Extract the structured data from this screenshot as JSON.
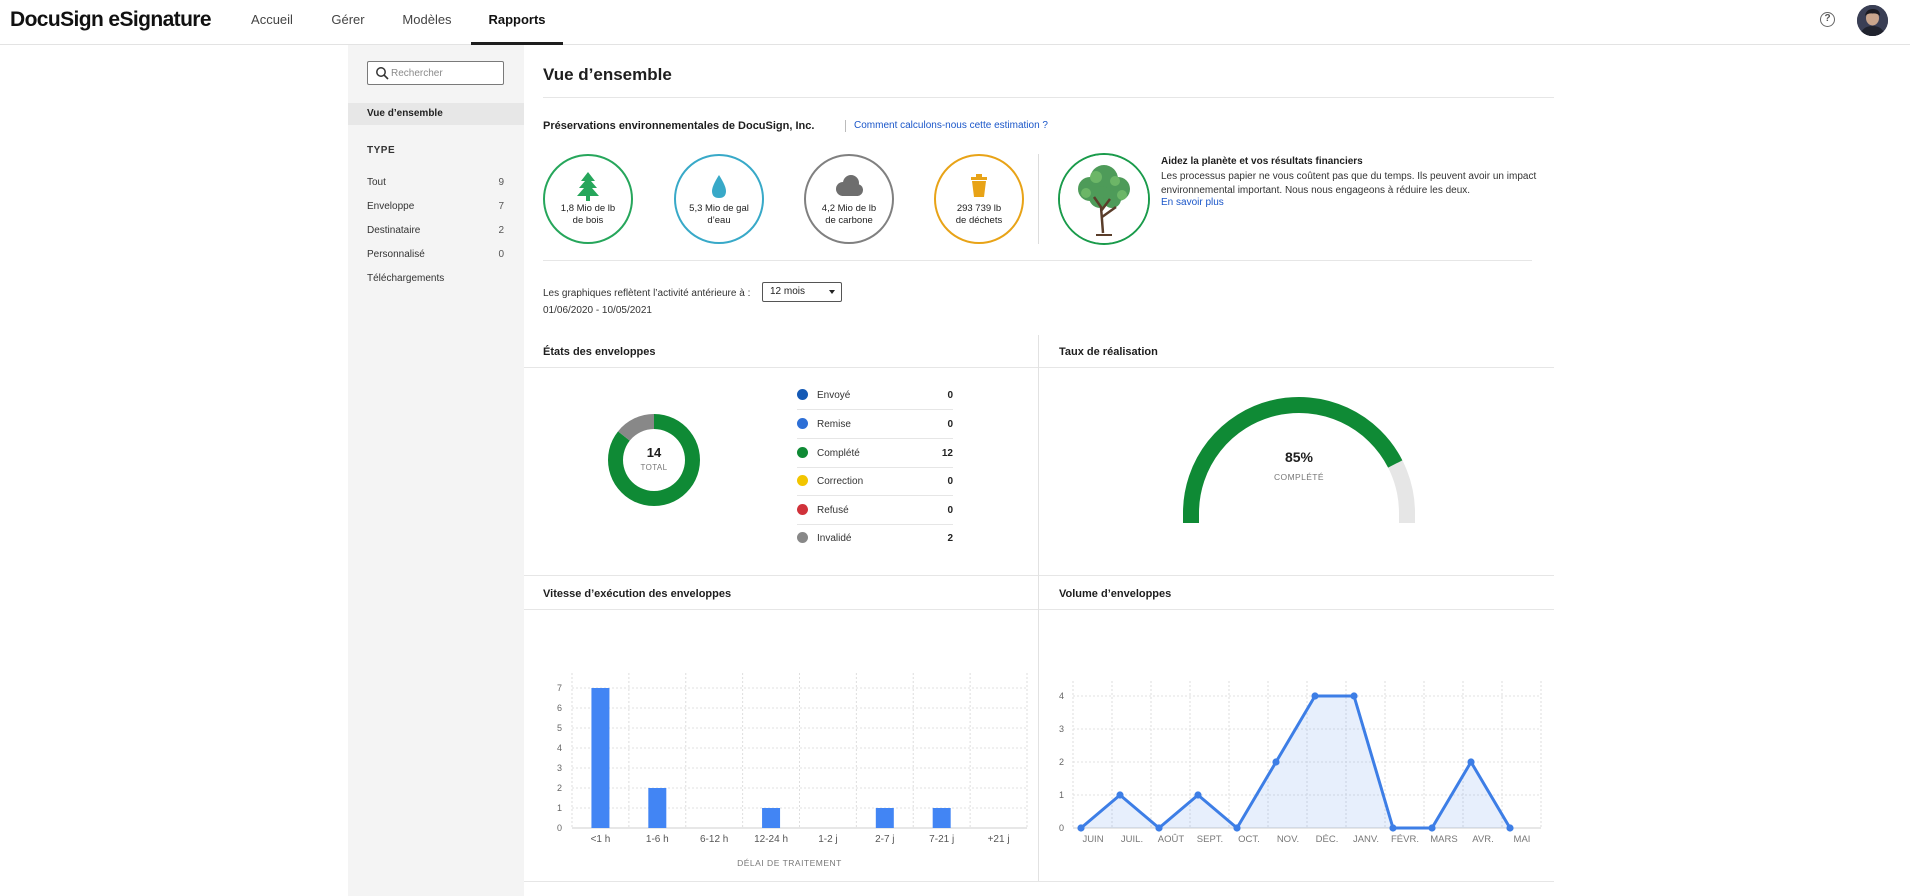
{
  "brand": "DocuSign eSignature",
  "nav": {
    "tabs": [
      {
        "label": "Accueil"
      },
      {
        "label": "Gérer"
      },
      {
        "label": "Modèles"
      },
      {
        "label": "Rapports",
        "active": true
      }
    ],
    "help_icon": "question-circle-icon"
  },
  "sidebar": {
    "search_placeholder": "Rechercher",
    "overview": "Vue d’ensemble",
    "type_heading": "TYPE",
    "items": [
      {
        "label": "Tout",
        "count": "9"
      },
      {
        "label": "Enveloppe",
        "count": "7"
      },
      {
        "label": "Destinataire",
        "count": "2"
      },
      {
        "label": "Personnalisé",
        "count": "0"
      },
      {
        "label": "Téléchargements",
        "count": ""
      }
    ]
  },
  "main": {
    "title": "Vue d’ensemble",
    "env": {
      "title": "Préservations environnementales de DocuSign, Inc.",
      "link": "Comment calculons-nous cette estimation ?",
      "metrics": [
        {
          "icon": "tree-icon",
          "line1": "1,8 Mio de lb",
          "line2": "de bois",
          "color": "#26a65b"
        },
        {
          "icon": "water-drop-icon",
          "line1": "5,3 Mio de gal",
          "line2": "d’eau",
          "color": "#38a9c8"
        },
        {
          "icon": "cloud-icon",
          "line1": "4,2 Mio de lb",
          "line2": "de carbone",
          "color": "#808080"
        },
        {
          "icon": "trash-icon",
          "line1": "293 739 lb",
          "line2": "de déchets",
          "color": "#e8a317"
        }
      ],
      "help_title": "Aidez la planète et vos résultats financiers",
      "help_text": "Les processus papier ne vous coûtent pas que du temps. Ils peuvent avoir un impact environnemental important. Nous nous engageons à réduire les deux.",
      "help_link": "En savoir plus"
    },
    "period": {
      "label": "Les graphiques reflètent l’activité antérieure à :",
      "selected": "12 mois",
      "range": "01/06/2020 - 10/05/2021"
    }
  },
  "panels": {
    "states": {
      "title": "États des enveloppes",
      "total": "14",
      "total_label": "TOTAL",
      "legend": [
        {
          "label": "Envoyé",
          "value": "0",
          "color": "#1459b5"
        },
        {
          "label": "Remise",
          "value": "0",
          "color": "#2d6fd6"
        },
        {
          "label": "Complété",
          "value": "12",
          "color": "#0f8a35"
        },
        {
          "label": "Correction",
          "value": "0",
          "color": "#f2c500"
        },
        {
          "label": "Refusé",
          "value": "0",
          "color": "#d0323a"
        },
        {
          "label": "Invalidé",
          "value": "2",
          "color": "#888888"
        }
      ]
    },
    "completion": {
      "title": "Taux de réalisation",
      "percent": "85%",
      "percent_value": 85,
      "label": "COMPLÉTÉ",
      "color": "#0f8a35",
      "track_color": "#e6e6e6"
    },
    "speed": {
      "title": "Vitesse d’exécution des enveloppes"
    },
    "volume": {
      "title": "Volume d’enveloppes"
    }
  },
  "chart_data": [
    {
      "type": "pie",
      "variant": "donut",
      "categories": [
        "Envoyé",
        "Remise",
        "Complété",
        "Correction",
        "Refusé",
        "Invalidé"
      ],
      "values": [
        0,
        0,
        12,
        0,
        0,
        2
      ]
    },
    {
      "type": "bar",
      "categories": [
        "<1 h",
        "1-6 h",
        "6-12 h",
        "12-24 h",
        "1-2 j",
        "2-7 j",
        "7-21 j",
        "+21 j"
      ],
      "values": [
        7,
        2,
        0,
        1,
        0,
        1,
        1,
        0
      ],
      "xlabel": "DÉLAI DE TRAITEMENT",
      "ylim": [
        0,
        7
      ],
      "yticks": [
        0,
        1,
        2,
        3,
        4,
        5,
        6,
        7
      ],
      "grid": true,
      "color": "#4285f4"
    },
    {
      "type": "area",
      "x": [
        "JUIN",
        "JUIL.",
        "AOÛT",
        "SEPT.",
        "OCT.",
        "NOV.",
        "DÉC.",
        "JANV.",
        "FÉVR.",
        "MARS",
        "AVR.",
        "MAI"
      ],
      "values": [
        0,
        1,
        0,
        1,
        0,
        2,
        4,
        4,
        0,
        0,
        2,
        0
      ],
      "ylim": [
        0,
        4
      ],
      "yticks": [
        0,
        1,
        2,
        3,
        4
      ],
      "grid": true,
      "color": "#3d7ee6"
    }
  ]
}
